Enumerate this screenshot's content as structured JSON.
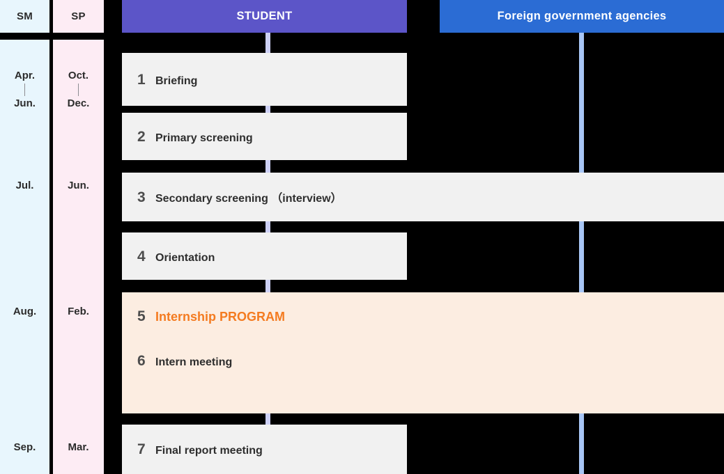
{
  "columns": {
    "sm": {
      "header": "SM",
      "color": "#E8F6FD",
      "cells": [
        {
          "top": "Apr.",
          "bottom": "Jun."
        },
        {
          "single": "Jul."
        },
        {
          "single": "Aug."
        },
        {
          "single": "Sep."
        }
      ]
    },
    "sp": {
      "header": "SP",
      "color": "#FDECF4",
      "cells": [
        {
          "top": "Oct.",
          "bottom": "Dec."
        },
        {
          "single": "Jun."
        },
        {
          "single": "Feb."
        },
        {
          "single": "Mar."
        }
      ]
    }
  },
  "lanes": [
    {
      "id": "student",
      "label": "STUDENT",
      "color": "#5C55C8",
      "rail_color": "#CDD0F5"
    },
    {
      "id": "agencies",
      "label": "Foreign government agencies",
      "color": "#2B6CD4",
      "rail_color": "#A8C6F5"
    }
  ],
  "steps": [
    {
      "number": "1",
      "label": "Briefing",
      "accent": false
    },
    {
      "number": "2",
      "label": "Primary screening",
      "accent": false
    },
    {
      "number": "3",
      "label": "Secondary screening （interview）",
      "accent": false
    },
    {
      "number": "4",
      "label": "Orientation",
      "accent": false
    },
    {
      "number": "5",
      "label": "Internship PROGRAM",
      "accent": true
    },
    {
      "number": "6",
      "label": "Intern meeting",
      "accent": false
    },
    {
      "number": "7",
      "label": "Final report meeting",
      "accent": false
    }
  ],
  "colors": {
    "card": "#F1F1F1",
    "program_block": "#FCEDE1",
    "accent": "#F47B20",
    "number": "#4D4D4D",
    "text": "#2E2E2E",
    "background": "#000000"
  }
}
